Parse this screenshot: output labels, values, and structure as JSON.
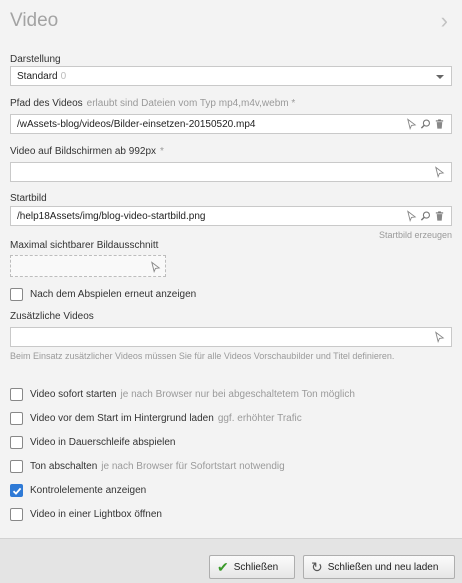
{
  "panel": {
    "title": "Video",
    "darstellung": {
      "label": "Darstellung",
      "value": "Standard",
      "count": "0"
    },
    "pfad": {
      "label": "Pfad des Videos",
      "hint": "erlaubt sind Dateien vom Typ mp4,m4v,webm *",
      "value": "/wAssets-blog/videos/Bilder-einsetzen-20150520.mp4"
    },
    "video992": {
      "label": "Video auf Bildschirmen ab 992px",
      "hint": "*",
      "value": ""
    },
    "startbild": {
      "label": "Startbild",
      "value": "/help18Assets/img/blog-video-startbild.png",
      "action": "Startbild erzeugen"
    },
    "ausschnitt": {
      "label": "Maximal sichtbarer Bildausschnitt"
    },
    "erneut": {
      "label": "Nach dem Abspielen erneut anzeigen",
      "checked": false
    },
    "zusaetzlich": {
      "label": "Zusätzliche Videos",
      "value": "",
      "note": "Beim Einsatz zusätzlicher Videos müssen Sie für alle Videos Vorschaubilder und Titel definieren."
    },
    "options": [
      {
        "label": "Video sofort starten",
        "hint": "je nach Browser nur bei abgeschaltetem Ton möglich",
        "checked": false
      },
      {
        "label": "Video vor dem Start im Hintergrund laden",
        "hint": "ggf. erhöhter Trafic",
        "checked": false
      },
      {
        "label": "Video in Dauerschleife abspielen",
        "hint": "",
        "checked": false
      },
      {
        "label": "Ton abschalten",
        "hint": "je nach Browser für Sofortstart notwendig",
        "checked": false
      },
      {
        "label": "Kontrolelemente anzeigen",
        "hint": "",
        "checked": true
      },
      {
        "label": "Video in einer Lightbox öffnen",
        "hint": "",
        "checked": false
      }
    ]
  },
  "footer": {
    "close_label": "Schließen",
    "reload_label": "Schließen und neu laden"
  },
  "colors": {
    "accent": "#2f7ad6",
    "ok_green": "#3a9a2a"
  },
  "icons": {
    "select": "cursor-pointer-icon",
    "search": "magnifier-icon",
    "delete": "trash-icon"
  }
}
